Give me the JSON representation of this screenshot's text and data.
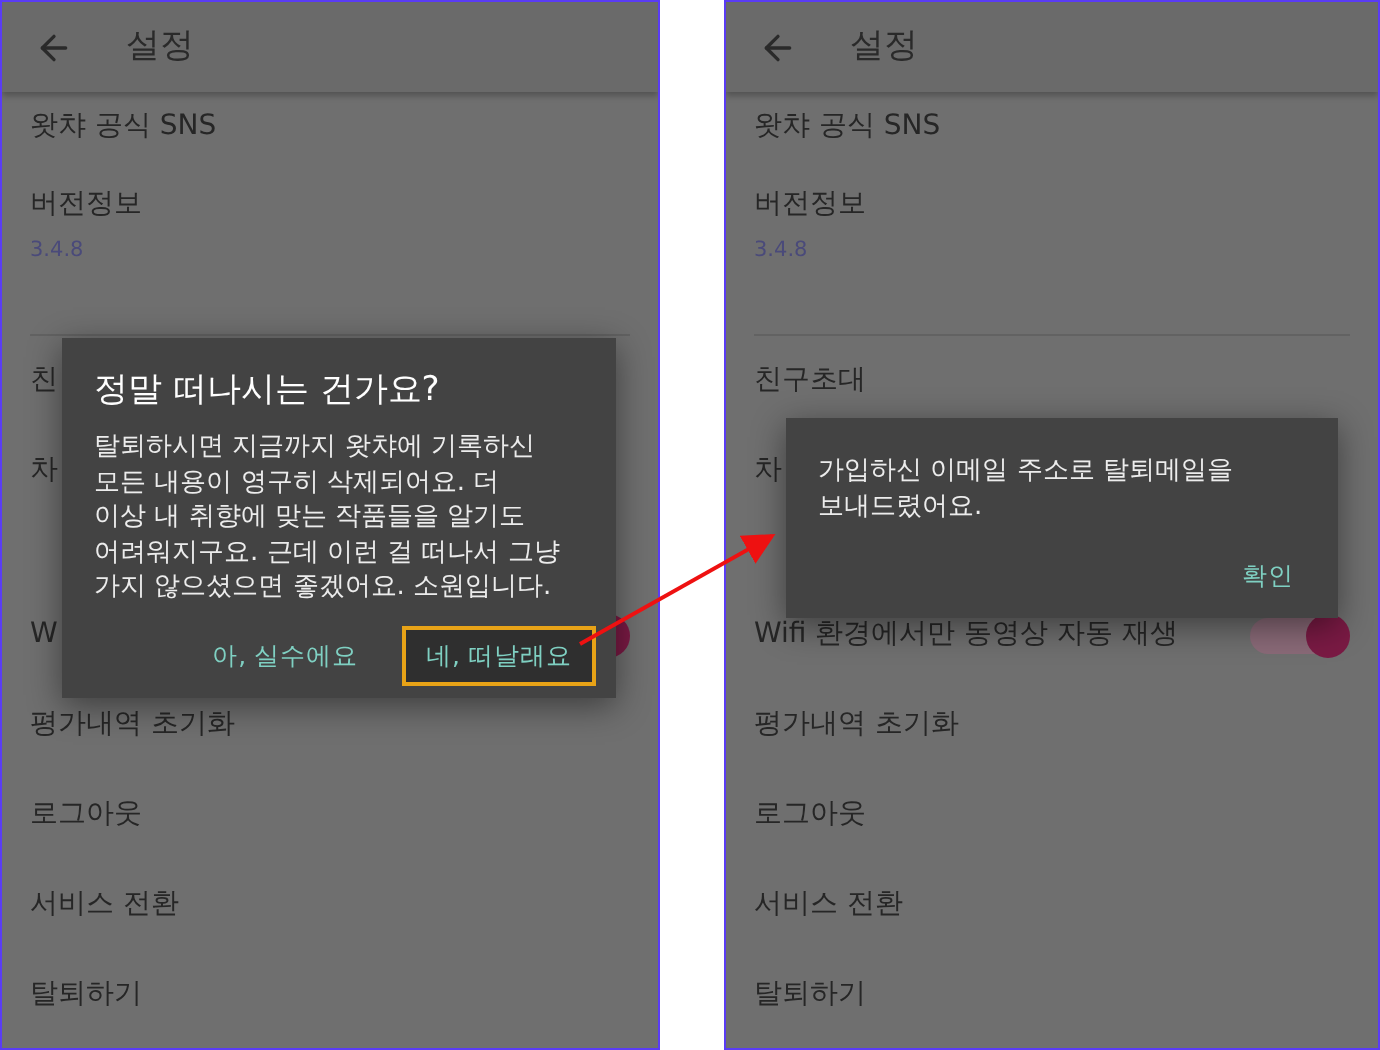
{
  "panels": [
    {
      "header": {
        "title": "설정"
      },
      "top_items": [
        {
          "kind": "link",
          "label": "왓챠 공식 SNS"
        },
        {
          "kind": "version",
          "label": "버전정보",
          "value": "3.4.8"
        }
      ],
      "items": [
        {
          "kind": "link",
          "label": "친"
        },
        {
          "kind": "link",
          "label": "차"
        },
        {
          "kind": "toggle",
          "label": "W",
          "on": true
        },
        {
          "kind": "link",
          "label": "평가내역 초기화"
        },
        {
          "kind": "link",
          "label": "로그아웃"
        },
        {
          "kind": "link",
          "label": "서비스 전환"
        },
        {
          "kind": "link",
          "label": "탈퇴하기"
        }
      ],
      "dialog": {
        "kind": "confirm",
        "title": "정말 떠나시는 건가요?",
        "body": "탈퇴하시면 지금까지 왓챠에 기록하신\n모든 내용이 영구히 삭제되어요. 더\n이상 내 취향에 맞는 작품들을 알기도\n어려워지구요. 근데 이런 걸 떠나서 그냥\n가지 않으셨으면 좋겠어요. 소원입니다.",
        "buttons": [
          {
            "label": "아, 실수에요",
            "highlighted": false
          },
          {
            "label": "네, 떠날래요",
            "highlighted": true
          }
        ]
      }
    },
    {
      "header": {
        "title": "설정"
      },
      "top_items": [
        {
          "kind": "link",
          "label": "왓챠 공식 SNS"
        },
        {
          "kind": "version",
          "label": "버전정보",
          "value": "3.4.8"
        }
      ],
      "items": [
        {
          "kind": "link",
          "label": "친구초대"
        },
        {
          "kind": "link",
          "label": "차"
        },
        {
          "kind": "toggle",
          "label": "Wifi 환경에서만 동영상 자동 재생",
          "on": true
        },
        {
          "kind": "link",
          "label": "평가내역 초기화"
        },
        {
          "kind": "link",
          "label": "로그아웃"
        },
        {
          "kind": "link",
          "label": "서비스 전환"
        },
        {
          "kind": "link",
          "label": "탈퇴하기"
        }
      ],
      "dialog": {
        "kind": "notice",
        "body": "가입하신 이메일 주소로 탈퇴메일을\n보내드렸어요.",
        "buttons": [
          {
            "label": "확인",
            "highlighted": false
          }
        ]
      }
    }
  ]
}
